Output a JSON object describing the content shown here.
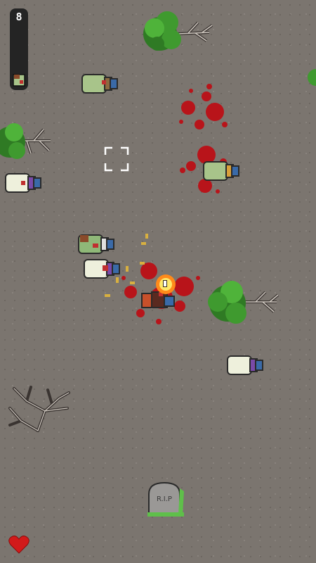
{
  "hud": {
    "ammo": "8",
    "lives": 1
  },
  "world": {
    "tombstone_text": "R.I.P"
  },
  "colors": {
    "ground": "#7b756f",
    "blood": "#b8141a",
    "zombie_skin": "#a8c48a",
    "tree_green": "#3f9a2f",
    "heart": "#d21a1a",
    "muzzle_flash": "#ffe86a"
  },
  "icons": {
    "crosshair": "crosshair-icon",
    "heart": "heart-icon"
  }
}
